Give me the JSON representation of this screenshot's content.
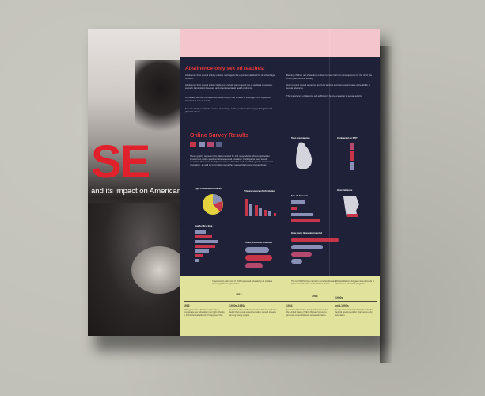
{
  "cover": {
    "title": "SE",
    "subtitle": "and its impact on American"
  },
  "section1": {
    "heading": "Abstinence-only sex ed teaches:",
    "para_left_1": "Abstinence from sexual activity outside marriage is the expected standard for all school-age children.",
    "para_left_2": "Abstinence from sexual activity is the only certain way to avoid out-of-wedlock pregnancy, sexually transmitted diseases, and other associated health problems.",
    "para_left_3": "A mutually faithful, monogamous relationship in the context of marriage is the expected standard of sexual activity.",
    "para_left_4": "Sexual activity outside the context of marriage is likely to have harmful psychological and physical effects.",
    "para_right_1": "Bearing children out of wedlock is likely to have harmful consequences for the child, the child's parents, and society.",
    "para_right_2": "How to reject sexual advances and how alcohol and drug use increase vulnerability to sexual advances.",
    "para_right_3": "The importance of attaining self-sufficiency before engaging in sexual activity."
  },
  "survey": {
    "heading": "Online Survey Results",
    "intro": "These graphs represent the data provided by 144 respondents who completed an anonymous online questionnaire on sexual education. Participants were asked questions about their background in sex education such as which gender and sexual orientation, as well as information about their sexual history and preparedness.",
    "chart_labels": {
      "type_of_education": "Type of education overall",
      "primary_source": "Primary source of information",
      "age_first_time": "Age for first time",
      "used_protection": "Used protection first time",
      "teen_pregnancies": "Teen pregnancies",
      "contracted_sti": "Contracted an STI?",
      "sex_ed_focus": "Sex ed focused",
      "how_religious": "How Religious",
      "how_prepared": "How many times unprotected"
    }
  },
  "timeline": [
    {
      "year": "1918",
      "text": "Chamberlain-Kahn Act of 1918 supported educating US soldiers about syphilis and gonorrhea."
    },
    {
      "year": "1986",
      "text": "The HIV/AIDS crisis carried in a higher demand for sexual education in the United States."
    },
    {
      "year": "1990s",
      "text": "Welfare Reform Act gave federal funds to abstinence education programs."
    }
  ],
  "timeline_bottom": [
    {
      "year": "1913",
      "text": "Chicago became the first major city to incorporate sex education into high schools in 1913; the Catholic church opposed this."
    },
    {
      "year": "1920s-1930s",
      "text": "Outbreak of sexually transmitted diseases led to a belief that sexual experimentation spread disease among young people."
    },
    {
      "year": "1964",
      "text": "Sexuality Information & Education Council of the United States (SIECUS) was formed to promote comprehensive sexual education."
    },
    {
      "year": "mid-1990s",
      "text": "Every state had funded initiatives by the federal government for abstinence-only education."
    }
  ],
  "colors": {
    "accent_red": "#e83a3a",
    "navy": "#1f2138",
    "pink": "#f2c6cc",
    "yellow": "#dfe39b"
  }
}
